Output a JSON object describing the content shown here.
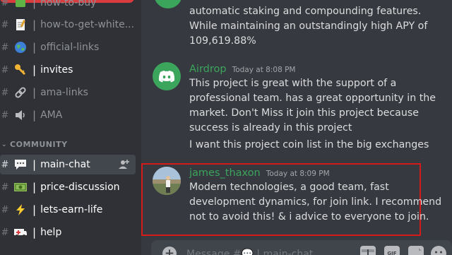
{
  "sidebar": {
    "channels_top": [
      {
        "emoji": "book-icon",
        "label": "how-to-buy",
        "unread": false
      },
      {
        "emoji": "memo-icon",
        "label": "how-to-get-white...",
        "unread": false
      },
      {
        "emoji": "globe-icon",
        "label": "official-links",
        "unread": false
      },
      {
        "emoji": "key-icon",
        "label": "invites",
        "unread": true
      },
      {
        "emoji": "link-icon",
        "label": "ama-links",
        "unread": false
      },
      {
        "emoji": "speaker-icon",
        "label": "AMA",
        "unread": false
      }
    ],
    "category": "COMMUNITY",
    "channels_community": [
      {
        "emoji": "speech-bubble-icon",
        "label": "main-chat",
        "active": true
      },
      {
        "emoji": "money-icon",
        "label": "price-discussion",
        "unread": true
      },
      {
        "emoji": "lightning-icon",
        "label": "lets-earn-life",
        "unread": true
      },
      {
        "emoji": "ambulance-icon",
        "label": "help",
        "unread": true
      }
    ]
  },
  "messages": {
    "partial": {
      "lines": [
        "automatic staking and compounding features.",
        "While maintaining an outstandingly high APY of",
        "109,619.88%"
      ]
    },
    "airdrop": {
      "username": "Airdrop",
      "timestamp": "Today at 8:08 PM",
      "lines": [
        "This project is great with the support of a",
        "professional team. has a great opportunity in the",
        "market. Don't Miss it join this project because",
        "success is already in this project"
      ],
      "followup": "I want this project coin list in the big exchanges"
    },
    "james": {
      "username": "james_thaxon",
      "timestamp": "Today at 8:09 PM",
      "lines": [
        "Modern technologies, a good team, fast",
        "development dynamics, for join link. I recommend",
        "not to avoid this! & i advice to everyone to join."
      ]
    }
  },
  "composer": {
    "placeholder": "Message #💬 | main-chat"
  },
  "colors": {
    "accent_green": "#3ba55c",
    "highlight_red": "#d51a1a"
  }
}
